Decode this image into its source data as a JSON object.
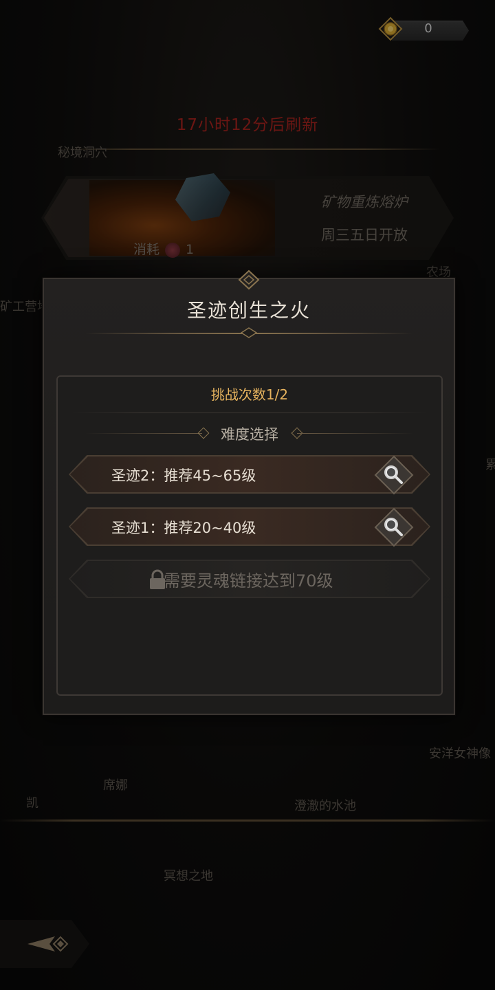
{
  "currency": {
    "value": "0",
    "icon": "gold-coin-icon"
  },
  "refresh_text": "17小时12分后刷新",
  "background_labels": {
    "secret_cave": "秘境洞穴",
    "farm": "农场",
    "mine_camp": "矿工营地",
    "right_edge": "累",
    "kai": "凯",
    "xina": "席娜",
    "clear_pool": "澄澈的水池",
    "goddess": "安洋女神像",
    "meditation": "冥想之地"
  },
  "furnace": {
    "title": "矿物重炼熔炉",
    "open_days": "周三五日开放",
    "consume_label": "消耗",
    "consume_count": "1"
  },
  "modal": {
    "title": "圣迹创生之火",
    "attempts": "挑战次数1/2",
    "difficulty_label": "难度选择",
    "options": [
      {
        "label": "圣迹2：推荐45~65级",
        "locked": false
      },
      {
        "label": "圣迹1：推荐20~40级",
        "locked": false
      },
      {
        "label": "需要灵魂链接达到70级",
        "locked": true
      }
    ]
  },
  "colors": {
    "refresh_red": "#a5221e",
    "attempts_gold": "#e6b35e",
    "frame_bronze": "#6b5a42"
  }
}
